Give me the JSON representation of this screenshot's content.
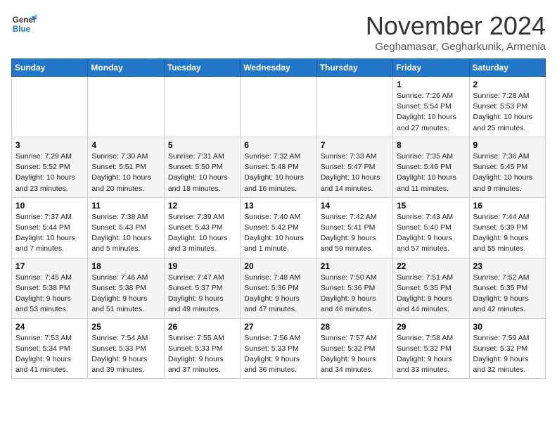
{
  "header": {
    "logo_line1": "General",
    "logo_line2": "Blue",
    "month_title": "November 2024",
    "location": "Geghamasar, Gegharkunik, Armenia"
  },
  "weekdays": [
    "Sunday",
    "Monday",
    "Tuesday",
    "Wednesday",
    "Thursday",
    "Friday",
    "Saturday"
  ],
  "weeks": [
    [
      {
        "day": "",
        "info": ""
      },
      {
        "day": "",
        "info": ""
      },
      {
        "day": "",
        "info": ""
      },
      {
        "day": "",
        "info": ""
      },
      {
        "day": "",
        "info": ""
      },
      {
        "day": "1",
        "info": "Sunrise: 7:26 AM\nSunset: 5:54 PM\nDaylight: 10 hours and 27 minutes."
      },
      {
        "day": "2",
        "info": "Sunrise: 7:28 AM\nSunset: 5:53 PM\nDaylight: 10 hours and 25 minutes."
      }
    ],
    [
      {
        "day": "3",
        "info": "Sunrise: 7:29 AM\nSunset: 5:52 PM\nDaylight: 10 hours and 23 minutes."
      },
      {
        "day": "4",
        "info": "Sunrise: 7:30 AM\nSunset: 5:51 PM\nDaylight: 10 hours and 20 minutes."
      },
      {
        "day": "5",
        "info": "Sunrise: 7:31 AM\nSunset: 5:50 PM\nDaylight: 10 hours and 18 minutes."
      },
      {
        "day": "6",
        "info": "Sunrise: 7:32 AM\nSunset: 5:48 PM\nDaylight: 10 hours and 16 minutes."
      },
      {
        "day": "7",
        "info": "Sunrise: 7:33 AM\nSunset: 5:47 PM\nDaylight: 10 hours and 14 minutes."
      },
      {
        "day": "8",
        "info": "Sunrise: 7:35 AM\nSunset: 5:46 PM\nDaylight: 10 hours and 11 minutes."
      },
      {
        "day": "9",
        "info": "Sunrise: 7:36 AM\nSunset: 5:45 PM\nDaylight: 10 hours and 9 minutes."
      }
    ],
    [
      {
        "day": "10",
        "info": "Sunrise: 7:37 AM\nSunset: 5:44 PM\nDaylight: 10 hours and 7 minutes."
      },
      {
        "day": "11",
        "info": "Sunrise: 7:38 AM\nSunset: 5:43 PM\nDaylight: 10 hours and 5 minutes."
      },
      {
        "day": "12",
        "info": "Sunrise: 7:39 AM\nSunset: 5:43 PM\nDaylight: 10 hours and 3 minutes."
      },
      {
        "day": "13",
        "info": "Sunrise: 7:40 AM\nSunset: 5:42 PM\nDaylight: 10 hours and 1 minute."
      },
      {
        "day": "14",
        "info": "Sunrise: 7:42 AM\nSunset: 5:41 PM\nDaylight: 9 hours and 59 minutes."
      },
      {
        "day": "15",
        "info": "Sunrise: 7:43 AM\nSunset: 5:40 PM\nDaylight: 9 hours and 57 minutes."
      },
      {
        "day": "16",
        "info": "Sunrise: 7:44 AM\nSunset: 5:39 PM\nDaylight: 9 hours and 55 minutes."
      }
    ],
    [
      {
        "day": "17",
        "info": "Sunrise: 7:45 AM\nSunset: 5:38 PM\nDaylight: 9 hours and 53 minutes."
      },
      {
        "day": "18",
        "info": "Sunrise: 7:46 AM\nSunset: 5:38 PM\nDaylight: 9 hours and 51 minutes."
      },
      {
        "day": "19",
        "info": "Sunrise: 7:47 AM\nSunset: 5:37 PM\nDaylight: 9 hours and 49 minutes."
      },
      {
        "day": "20",
        "info": "Sunrise: 7:48 AM\nSunset: 5:36 PM\nDaylight: 9 hours and 47 minutes."
      },
      {
        "day": "21",
        "info": "Sunrise: 7:50 AM\nSunset: 5:36 PM\nDaylight: 9 hours and 46 minutes."
      },
      {
        "day": "22",
        "info": "Sunrise: 7:51 AM\nSunset: 5:35 PM\nDaylight: 9 hours and 44 minutes."
      },
      {
        "day": "23",
        "info": "Sunrise: 7:52 AM\nSunset: 5:35 PM\nDaylight: 9 hours and 42 minutes."
      }
    ],
    [
      {
        "day": "24",
        "info": "Sunrise: 7:53 AM\nSunset: 5:34 PM\nDaylight: 9 hours and 41 minutes."
      },
      {
        "day": "25",
        "info": "Sunrise: 7:54 AM\nSunset: 5:33 PM\nDaylight: 9 hours and 39 minutes."
      },
      {
        "day": "26",
        "info": "Sunrise: 7:55 AM\nSunset: 5:33 PM\nDaylight: 9 hours and 37 minutes."
      },
      {
        "day": "27",
        "info": "Sunrise: 7:56 AM\nSunset: 5:33 PM\nDaylight: 9 hours and 36 minutes."
      },
      {
        "day": "28",
        "info": "Sunrise: 7:57 AM\nSunset: 5:32 PM\nDaylight: 9 hours and 34 minutes."
      },
      {
        "day": "29",
        "info": "Sunrise: 7:58 AM\nSunset: 5:32 PM\nDaylight: 9 hours and 33 minutes."
      },
      {
        "day": "30",
        "info": "Sunrise: 7:59 AM\nSunset: 5:32 PM\nDaylight: 9 hours and 32 minutes."
      }
    ]
  ]
}
